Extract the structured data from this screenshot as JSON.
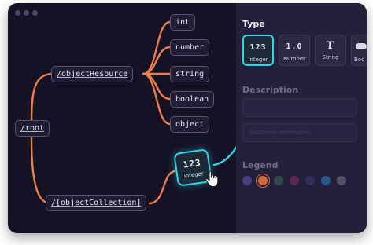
{
  "window": {
    "controls": [
      "close",
      "minimize",
      "maximize"
    ]
  },
  "tree": {
    "root": "/root",
    "object_resource": "/objectResource",
    "object_collection": "/[objectCollection]",
    "types": [
      "int",
      "number",
      "string",
      "boolean",
      "object"
    ]
  },
  "drag_card": {
    "glyph": "123",
    "label": "integer"
  },
  "panel": {
    "type_heading": "Type",
    "type_options": [
      {
        "glyph": "123",
        "label": "Integer",
        "active": true
      },
      {
        "glyph": "1.0",
        "label": "Number",
        "active": false
      },
      {
        "glyph": "T",
        "label": "String",
        "active": false
      },
      {
        "glyph": "",
        "label": "Boo",
        "active": false
      }
    ],
    "description_heading": "Description",
    "description_placeholder": "",
    "description_extra_placeholder": "Additional information",
    "legend_heading": "Legend",
    "legend_colors": [
      "#6b5bb5",
      "#e8703a",
      "#3a6a58",
      "#8a2e5e",
      "#3f3c74",
      "#2f86d2",
      "#7a7a86"
    ]
  },
  "colors": {
    "background": "#141225",
    "panel": "#22203a",
    "link": "#f07c49",
    "accent": "#35d3e4"
  }
}
